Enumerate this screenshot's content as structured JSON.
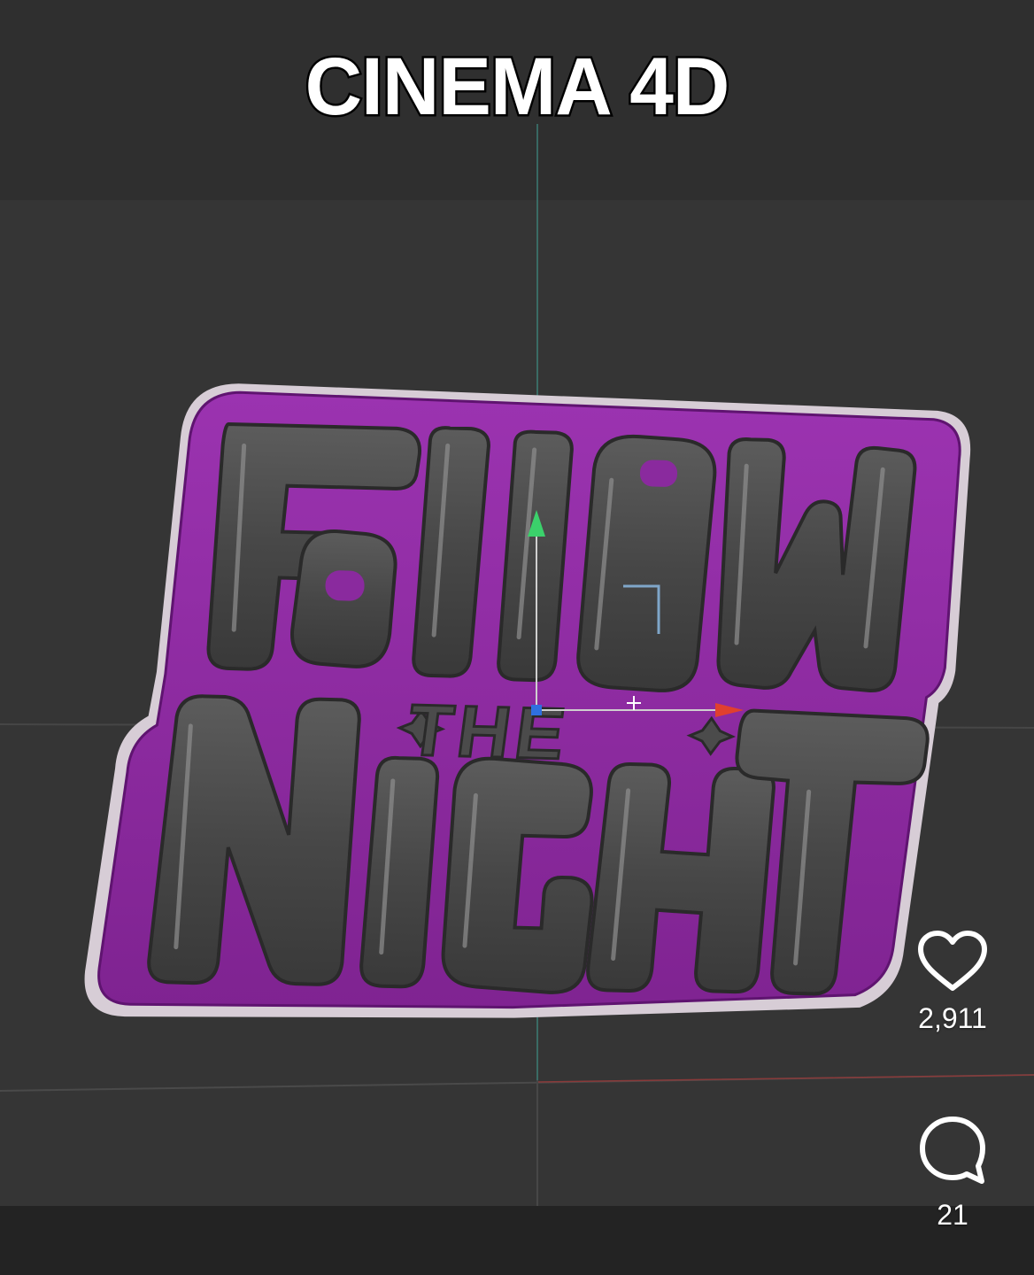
{
  "overlay": {
    "title": "CINEMA 4D"
  },
  "artwork": {
    "line1": "FOLLOW",
    "line2": "THE",
    "line3": "NIGHT",
    "colors": {
      "purple": "#8a2a9e",
      "purple_light": "#a745b8",
      "letter_gray": "#4a4a4a",
      "outline": "#d9cfd9"
    }
  },
  "actions": {
    "likes": "2,911",
    "comments": "21",
    "like_icon": "heart-icon",
    "comment_icon": "comment-bubble-icon"
  },
  "colors": {
    "x_axis": "#e0402e",
    "y_axis": "#3bd16b",
    "z_axis": "#2f6fe0"
  }
}
